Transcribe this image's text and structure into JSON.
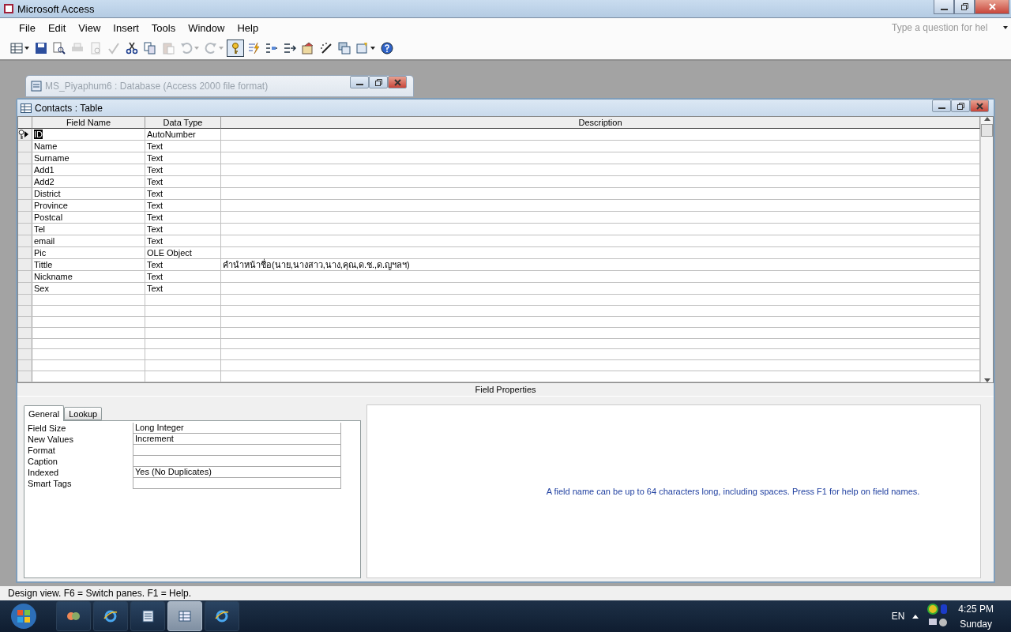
{
  "app_window": {
    "title": "Microsoft Access"
  },
  "menu": [
    {
      "label": "File"
    },
    {
      "label": "Edit"
    },
    {
      "label": "View"
    },
    {
      "label": "Insert"
    },
    {
      "label": "Tools"
    },
    {
      "label": "Window"
    },
    {
      "label": "Help"
    }
  ],
  "help_box": {
    "placeholder": "Type a question for hel"
  },
  "toolbar": [
    {
      "kind": "view",
      "disabled": false,
      "pressed": false,
      "dropdown": true
    },
    {
      "kind": "save",
      "disabled": false,
      "pressed": false,
      "dropdown": false
    },
    {
      "kind": "search",
      "disabled": false,
      "pressed": false,
      "dropdown": false
    },
    {
      "kind": "print",
      "disabled": true,
      "pressed": false,
      "dropdown": false
    },
    {
      "kind": "preview",
      "disabled": true,
      "pressed": false,
      "dropdown": false
    },
    {
      "kind": "spell",
      "disabled": true,
      "pressed": false,
      "dropdown": false
    },
    {
      "kind": "cut",
      "disabled": false,
      "pressed": false,
      "dropdown": false
    },
    {
      "kind": "copy",
      "disabled": false,
      "pressed": false,
      "dropdown": false
    },
    {
      "kind": "paste",
      "disabled": true,
      "pressed": false,
      "dropdown": false
    },
    {
      "kind": "undo",
      "disabled": true,
      "pressed": false,
      "dropdown": true
    },
    {
      "kind": "redo",
      "disabled": true,
      "pressed": false,
      "dropdown": true
    },
    {
      "kind": "key",
      "disabled": false,
      "pressed": true,
      "dropdown": false
    },
    {
      "kind": "lightning",
      "disabled": false,
      "pressed": false,
      "dropdown": false
    },
    {
      "kind": "insert-rows",
      "disabled": false,
      "pressed": false,
      "dropdown": false
    },
    {
      "kind": "delete-rows",
      "disabled": false,
      "pressed": false,
      "dropdown": false
    },
    {
      "kind": "properties",
      "disabled": false,
      "pressed": false,
      "dropdown": false
    },
    {
      "kind": "build",
      "disabled": false,
      "pressed": false,
      "dropdown": false
    },
    {
      "kind": "database",
      "disabled": false,
      "pressed": false,
      "dropdown": false
    },
    {
      "kind": "new-object",
      "disabled": false,
      "pressed": false,
      "dropdown": true
    },
    {
      "kind": "help",
      "disabled": false,
      "pressed": false,
      "dropdown": false
    }
  ],
  "database_window": {
    "title": "MS_Piyaphum6 : Database (Access 2000 file format)"
  },
  "table_window": {
    "title": "Contacts : Table",
    "columns": [
      "Field Name",
      "Data Type",
      "Description"
    ],
    "rows": [
      {
        "field_name": "ID",
        "data_type": "AutoNumber",
        "description": "",
        "primary_key": true,
        "current": true
      },
      {
        "field_name": "Name",
        "data_type": "Text",
        "description": "",
        "primary_key": false,
        "current": false
      },
      {
        "field_name": "Surname",
        "data_type": "Text",
        "description": "",
        "primary_key": false,
        "current": false
      },
      {
        "field_name": "Add1",
        "data_type": "Text",
        "description": "",
        "primary_key": false,
        "current": false
      },
      {
        "field_name": "Add2",
        "data_type": "Text",
        "description": "",
        "primary_key": false,
        "current": false
      },
      {
        "field_name": "District",
        "data_type": "Text",
        "description": "",
        "primary_key": false,
        "current": false
      },
      {
        "field_name": "Province",
        "data_type": "Text",
        "description": "",
        "primary_key": false,
        "current": false
      },
      {
        "field_name": "Postcal",
        "data_type": "Text",
        "description": "",
        "primary_key": false,
        "current": false
      },
      {
        "field_name": "Tel",
        "data_type": "Text",
        "description": "",
        "primary_key": false,
        "current": false
      },
      {
        "field_name": "email",
        "data_type": "Text",
        "description": "",
        "primary_key": false,
        "current": false
      },
      {
        "field_name": "Pic",
        "data_type": "OLE Object",
        "description": "",
        "primary_key": false,
        "current": false
      },
      {
        "field_name": "Tittle",
        "data_type": "Text",
        "description": "คำนำหน้าชื่อ(นาย,นางสาว,นาง,คุณ,ด.ช.,ด.ญฯลฯ)",
        "primary_key": false,
        "current": false
      },
      {
        "field_name": "Nickname",
        "data_type": "Text",
        "description": "",
        "primary_key": false,
        "current": false
      },
      {
        "field_name": "Sex",
        "data_type": "Text",
        "description": "",
        "primary_key": false,
        "current": false
      }
    ],
    "field_properties": {
      "heading": "Field Properties",
      "tabs": [
        {
          "label": "General",
          "selected": true
        },
        {
          "label": "Lookup",
          "selected": false
        }
      ],
      "properties": [
        {
          "label": "Field Size",
          "value": "Long Integer"
        },
        {
          "label": "New Values",
          "value": "Increment"
        },
        {
          "label": "Format"
        },
        {
          "label": "Caption"
        },
        {
          "label": "Indexed",
          "value": "Yes (No Duplicates)"
        },
        {
          "label": "Smart Tags"
        }
      ],
      "hint": "A field name can be up to 64 characters long, including spaces.  Press F1 for help on field names."
    }
  },
  "status_bar": "Design view.  F6 = Switch panes.  F1 = Help.",
  "taskbar": {
    "buttons": [
      {
        "kind": "app",
        "selected": false
      },
      {
        "kind": "browser",
        "selected": false
      },
      {
        "kind": "database",
        "selected": false
      },
      {
        "kind": "table",
        "selected": true
      },
      {
        "kind": "browser",
        "selected": false
      }
    ],
    "language": "EN",
    "time": "4:25 PM",
    "day": "Sunday"
  }
}
